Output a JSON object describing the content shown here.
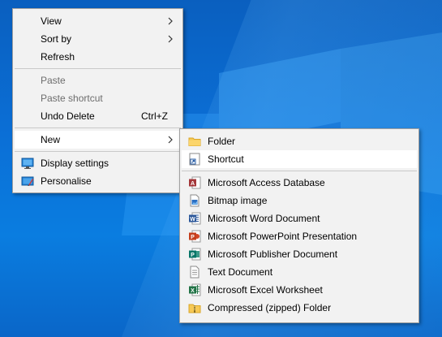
{
  "context_menu": {
    "items": [
      {
        "label": "View"
      },
      {
        "label": "Sort by"
      },
      {
        "label": "Refresh"
      },
      {
        "label": "Paste"
      },
      {
        "label": "Paste shortcut"
      },
      {
        "label": "Undo Delete",
        "shortcut": "Ctrl+Z"
      },
      {
        "label": "New"
      },
      {
        "label": "Display settings"
      },
      {
        "label": "Personalise"
      }
    ]
  },
  "new_submenu": {
    "items": [
      {
        "label": "Folder",
        "icon": "folder-icon"
      },
      {
        "label": "Shortcut",
        "icon": "shortcut-icon"
      },
      {
        "label": "Microsoft Access Database",
        "icon": "access-icon"
      },
      {
        "label": "Bitmap image",
        "icon": "bitmap-icon"
      },
      {
        "label": "Microsoft Word Document",
        "icon": "word-icon"
      },
      {
        "label": "Microsoft PowerPoint Presentation",
        "icon": "powerpoint-icon"
      },
      {
        "label": "Microsoft Publisher Document",
        "icon": "publisher-icon"
      },
      {
        "label": "Text Document",
        "icon": "text-document-icon"
      },
      {
        "label": "Microsoft Excel Worksheet",
        "icon": "excel-icon"
      },
      {
        "label": "Compressed (zipped) Folder",
        "icon": "zip-folder-icon"
      }
    ]
  },
  "colors": {
    "menu_bg": "#f2f2f2",
    "highlight": "#ffffff",
    "disabled_text": "#6d6d6d",
    "desktop": "#0b6fd6"
  }
}
